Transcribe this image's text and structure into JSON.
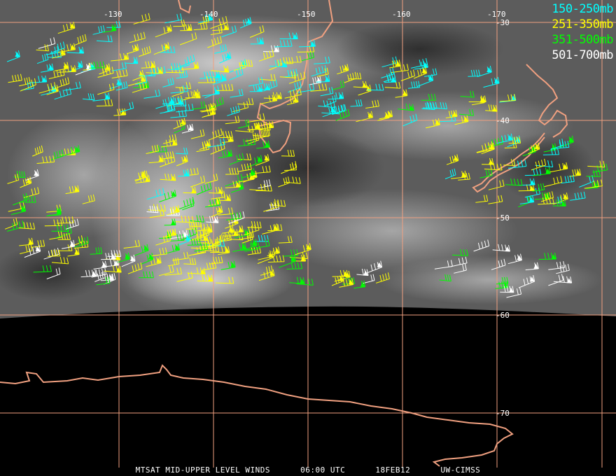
{
  "map": {
    "longitude_labels": [
      "-130",
      "-140",
      "-150",
      "-160",
      "-170"
    ],
    "latitude_labels": [
      "-30",
      "-40",
      "-50",
      "-60",
      "-70"
    ],
    "colors": {
      "graticule": "#f0a080",
      "coastline": "#f0a080",
      "space": "#000000"
    }
  },
  "legend": [
    {
      "label": "150-250mb",
      "color": "#00ffff"
    },
    {
      "label": "251-350mb",
      "color": "#ffff00"
    },
    {
      "label": "351-500mb",
      "color": "#00ff00"
    },
    {
      "label": "501-700mb",
      "color": "#ffffff"
    }
  ],
  "footer": {
    "product": "MTSAT MID-UPPER LEVEL WINDS",
    "time": "06:00 UTC",
    "date": "18FEB12",
    "source": "UW-CIMSS"
  }
}
